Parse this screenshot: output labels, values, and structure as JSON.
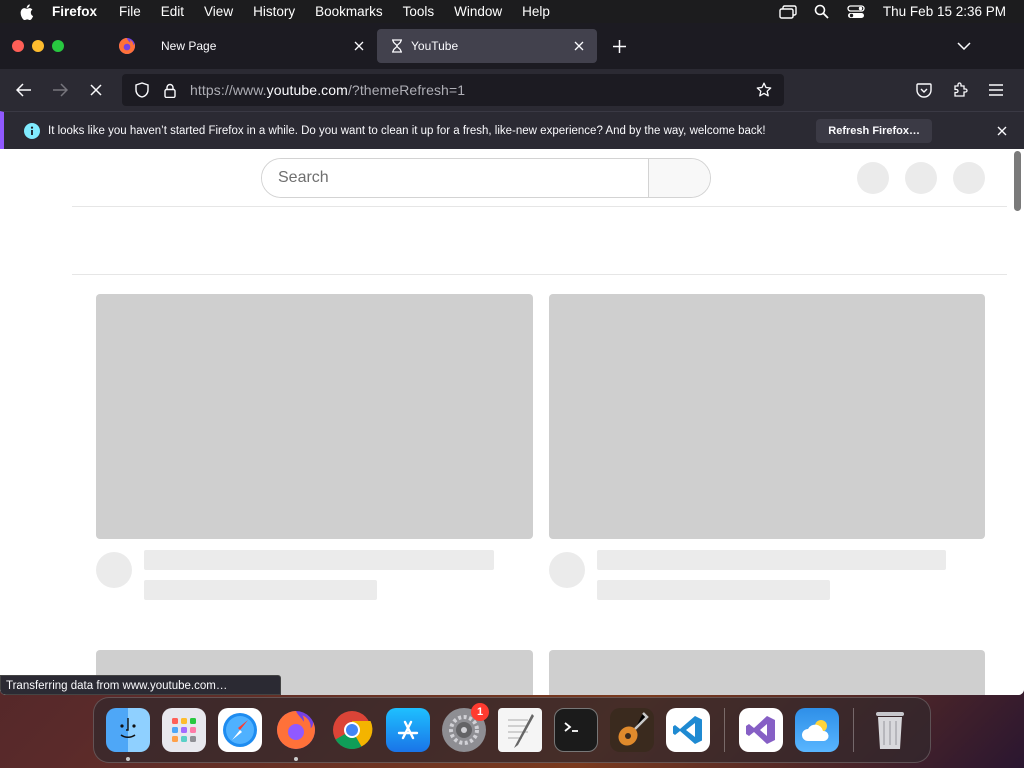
{
  "menubar": {
    "app_name": "Firefox",
    "items": [
      "File",
      "Edit",
      "View",
      "History",
      "Bookmarks",
      "Tools",
      "Window",
      "Help"
    ],
    "clock": "Thu Feb 15  2:36 PM"
  },
  "tabs": {
    "pinned_icon": "firefox-icon",
    "inactive": {
      "title": "New Page"
    },
    "active": {
      "title": "YouTube",
      "icon": "hourglass-icon"
    }
  },
  "navbar": {
    "url_prefix": "https://www.",
    "url_host": "youtube.com",
    "url_suffix": "/?themeRefresh=1"
  },
  "notification": {
    "text": "It looks like you haven’t started Firefox in a while. Do you want to clean it up for a fresh, like-new experience? And by the way, welcome back!",
    "button_label": "Refresh Firefox…"
  },
  "youtube": {
    "search_placeholder": "Search"
  },
  "statusbar": {
    "text": "Transferring data from www.youtube.com…"
  },
  "dock": {
    "apps": [
      "Finder",
      "Launchpad",
      "Safari",
      "Firefox",
      "Chrome",
      "App Store",
      "System Settings",
      "TextEdit",
      "Terminal",
      "GarageBand",
      "Visual Studio Code",
      "Visual Studio",
      "Weather",
      "Trash"
    ],
    "settings_badge": "1"
  },
  "colors": {
    "accent": "#9059ff",
    "tab_active": "#42414d",
    "toolbar": "#2b2a33",
    "skeleton": "#cfcfcf"
  }
}
